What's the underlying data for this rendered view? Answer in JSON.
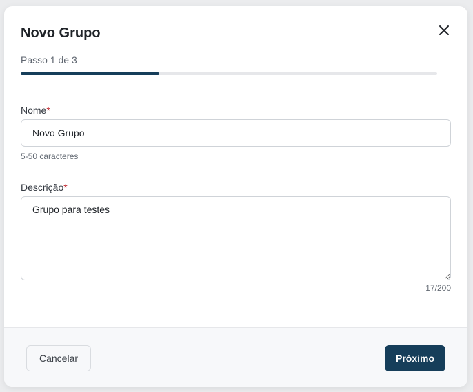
{
  "dialog": {
    "title": "Novo Grupo",
    "close_icon": "close-icon",
    "step_label": "Passo 1 de 3",
    "progress_fraction": 0.333,
    "accent_color": "#163e5a"
  },
  "form": {
    "name": {
      "label": "Nome",
      "required_marker": "*",
      "value": "Novo Grupo",
      "hint": "5-50 caracteres"
    },
    "description": {
      "label": "Descrição",
      "required_marker": "*",
      "value": "Grupo para testes",
      "counter": "17/200"
    }
  },
  "footer": {
    "cancel_label": "Cancelar",
    "next_label": "Próximo"
  }
}
